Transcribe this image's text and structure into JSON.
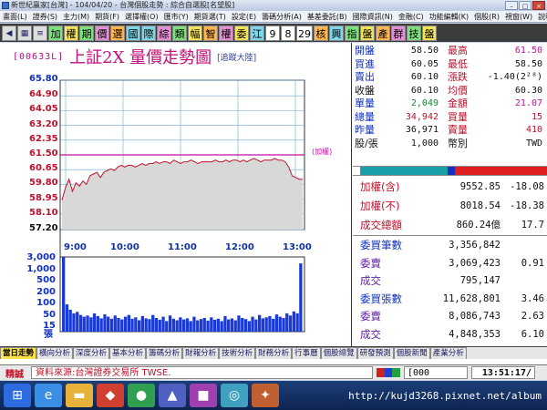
{
  "window": {
    "title": "新世紀贏家[台灣] - 104/04/20 - 台灣個股走勢 : 綜合自選股[名望股]"
  },
  "menu": [
    "畫面(L)",
    "證券(S)",
    "主力(M)",
    "期貨(F)",
    "選擇權(O)",
    "匯市(Y)",
    "期貨選(T)",
    "設定(E)",
    "籌碼分析(A)",
    "基差委託(B)",
    "國際資訊(N)",
    "金融(C)",
    "功能編輯(K)",
    "個股(R)",
    "視窗(W)",
    "說明(H)"
  ],
  "toolbar": {
    "buttons": [
      "加",
      "權",
      "期",
      "價",
      "選",
      "國",
      "際",
      "綜",
      "類",
      "幅",
      "智",
      "權",
      "委",
      "江",
      "9",
      "8",
      "29",
      "核",
      "興",
      "指",
      "盤",
      "產",
      "群",
      "技",
      "盤"
    ]
  },
  "chart_header": {
    "code": "[00633L]",
    "title": "上証2X  量價走勢圖",
    "subtitle": "[追蹤大陸]",
    "legend_note": "(加權)"
  },
  "chart_data": {
    "type": "line",
    "price_ticks": [
      "65.80",
      "64.90",
      "64.05",
      "63.20",
      "62.35",
      "61.50",
      "60.65",
      "59.80",
      "58.95",
      "58.10",
      "57.20"
    ],
    "price_tick_values": [
      65.8,
      64.9,
      64.05,
      63.2,
      62.35,
      61.5,
      60.65,
      59.8,
      58.95,
      58.1,
      57.2
    ],
    "volume_ticks": [
      "3,000",
      "1,000",
      "500",
      "200",
      "100",
      "50",
      "15"
    ],
    "volume_unit": "張",
    "time_ticks": [
      "9:00",
      "10:00",
      "11:00",
      "12:00",
      "13:00"
    ],
    "ylim": [
      57.2,
      65.8
    ],
    "reference_price": 61.5,
    "limit_line": 61.5,
    "price_series": [
      58.9,
      59.6,
      60.1,
      59.4,
      59.9,
      59.7,
      60.0,
      59.8,
      60.3,
      60.4,
      60.5,
      60.2,
      60.5,
      60.6,
      60.7,
      60.6,
      60.8,
      60.9,
      60.8,
      60.9,
      60.9,
      60.8,
      60.9,
      61.0,
      60.9,
      61.0,
      61.0,
      61.1,
      61.0,
      61.1,
      61.1,
      61.0,
      61.2,
      61.1,
      61.0,
      61.1,
      61.1,
      61.2,
      61.1,
      61.0,
      61.1,
      61.1,
      61.1,
      61.1,
      61.2,
      61.1,
      61.1,
      61.2,
      61.1,
      61.2,
      61.2,
      61.1,
      61.2,
      61.1,
      61.2,
      61.3,
      61.2,
      61.1,
      61.2,
      61.2,
      61.2,
      61.3,
      61.2,
      61.2,
      61.1,
      60.8,
      60.3,
      60.2,
      60.1,
      60.1
    ],
    "volume_series": [
      3000,
      400,
      260,
      180,
      210,
      150,
      120,
      140,
      110,
      180,
      130,
      95,
      160,
      120,
      90,
      140,
      100,
      80,
      120,
      150,
      90,
      110,
      70,
      130,
      95,
      85,
      150,
      100,
      75,
      120,
      60,
      140,
      90,
      70,
      110,
      80,
      95,
      60,
      120,
      70,
      85,
      100,
      65,
      110,
      75,
      90,
      60,
      130,
      80,
      95,
      70,
      140,
      100,
      85,
      60,
      120,
      80,
      150,
      95,
      110,
      130,
      90,
      160,
      120,
      100,
      180,
      140,
      220,
      180,
      2500
    ]
  },
  "quote": {
    "rows": [
      {
        "k1": "開盤",
        "v1": "58.50",
        "k2": "最高",
        "v2": "61.50"
      },
      {
        "k1": "買進",
        "v1": "60.05",
        "k2": "最低",
        "v2": "58.50"
      },
      {
        "k1": "賣出",
        "v1": "60.10",
        "k2": "漲跌",
        "v2": "-1.40(2²⁸)"
      },
      {
        "k1": "收盤",
        "v1": "60.10",
        "k2": "均價",
        "v2": "60.30"
      },
      {
        "k1": "單量",
        "v1": "2,049",
        "k2": "金額",
        "v2": "21.07"
      },
      {
        "k1": "總量",
        "v1": "34,942",
        "k2": "買量",
        "v2": "15"
      },
      {
        "k1": "昨量",
        "v1": "36,971",
        "k2": "賣量",
        "v2": "410"
      },
      {
        "k1": "股/張",
        "v1": "1,000",
        "k2": "幣別",
        "v2": "TWD"
      }
    ]
  },
  "index": {
    "rows": [
      {
        "k": "加權(含)",
        "v": "9552.85",
        "c": "-18.08"
      },
      {
        "k": "加權(不)",
        "v": "8018.54",
        "c": "-18.38"
      },
      {
        "k": "成交總額",
        "v": "860.24億",
        "c": "17.7"
      }
    ]
  },
  "volume_stats": {
    "rows": [
      {
        "k": "委買筆數",
        "v": "3,356,842",
        "c": ""
      },
      {
        "k": "委賣",
        "v": "3,069,423",
        "c": "0.91"
      },
      {
        "k": "成交",
        "v": "795,147",
        "c": ""
      },
      {
        "k": "委買張數",
        "v": "11,628,801",
        "c": "3.46"
      },
      {
        "k": "委賣",
        "v": "8,086,743",
        "c": "2.63"
      },
      {
        "k": "成交",
        "v": "4,848,353",
        "c": "6.10"
      }
    ]
  },
  "tabs": [
    "當日走勢",
    "橫向分析",
    "深度分析",
    "基本分析",
    "籌碼分析",
    "財報分析",
    "技術分析",
    "財務分析",
    "行事曆",
    "個股總覽",
    "研發預測",
    "個股新聞",
    "產業分析"
  ],
  "status": {
    "label": "精誠",
    "source": "資料來源:台灣證券交易所 TWSE.",
    "count": "[000",
    "time": "13:51:17/"
  },
  "taskbar": {
    "url": "http://kujd3268.pixnet.net/album"
  },
  "colors": {
    "price_line": "#c0102a",
    "reference_line": "#c010a0",
    "volume_bar": "#1a3ad8",
    "grid": "#6aa8d8"
  }
}
